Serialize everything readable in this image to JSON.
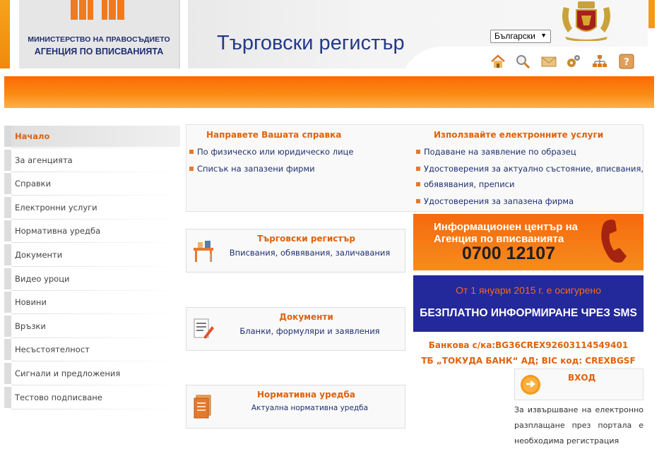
{
  "header": {
    "logo_line1": "МИНИСТЕРСТВО НА ПРАВОСЪДИЕТО",
    "logo_line2": "АГЕНЦИЯ ПО ВПИСВАНИЯТА",
    "site_title": "Търговски регистър",
    "language": "Български",
    "toolbar_icons": [
      "home-icon",
      "search-icon",
      "mail-icon",
      "settings-icon",
      "sitemap-icon",
      "help-icon"
    ]
  },
  "sidebar": {
    "items": [
      {
        "label": "Начало",
        "active": true
      },
      {
        "label": "За агенцията"
      },
      {
        "label": "Справки"
      },
      {
        "label": "Електронни услуги"
      },
      {
        "label": "Нормативна уредба"
      },
      {
        "label": "Документи"
      },
      {
        "label": "Видео уроци"
      },
      {
        "label": "Новини"
      },
      {
        "label": "Връзки"
      },
      {
        "label": "Несъстоятелност"
      },
      {
        "label": "Сигнали и предложения"
      },
      {
        "label": "Тестово подписване"
      }
    ]
  },
  "services": {
    "left_title": "Направете Вашата справка",
    "left_links": [
      "По физическо или юридическо лице",
      "Списък на запазени фирми"
    ],
    "right_title": "Използвайте електронните услуги",
    "right_links": [
      "Подаване на заявление по образец",
      "Удостоверения за актуално състояние, вписвания,",
      "обявявания, преписи",
      "Удостоверения за запазена фирма"
    ]
  },
  "cards": [
    {
      "title": "Търговски регистър",
      "subtitle": "Вписвания, обявявания, заличавания"
    },
    {
      "title": "Документи",
      "subtitle": "Бланки, формуляри и заявления"
    },
    {
      "title": "Нормативна уредба",
      "subtitle": "Актуална нормативна уредба"
    }
  ],
  "info_banner": {
    "line1": "Информационен център на",
    "line2": "Агенция по вписванията",
    "phone": "0700 12107"
  },
  "sms_banner": {
    "line1": "От 1 януари 2015 г. е осигурено",
    "line2": "БЕЗПЛАТНО ИНФОРМИРАНЕ ЧРЕЗ SMS"
  },
  "bank": {
    "line1": "Банкова с/ка:BG36CREX92603114549401",
    "line2": "ТБ „ТОКУДА БАНК“ АД; BIC код: CREXBGSF"
  },
  "login": {
    "title": "ВХОД",
    "text": "За извършване на електронно разплащане през портала е необходима регистрация"
  },
  "colors": {
    "accent_orange": "#e0620c",
    "navy": "#1f2f6d",
    "sms_blue": "#23289b"
  }
}
